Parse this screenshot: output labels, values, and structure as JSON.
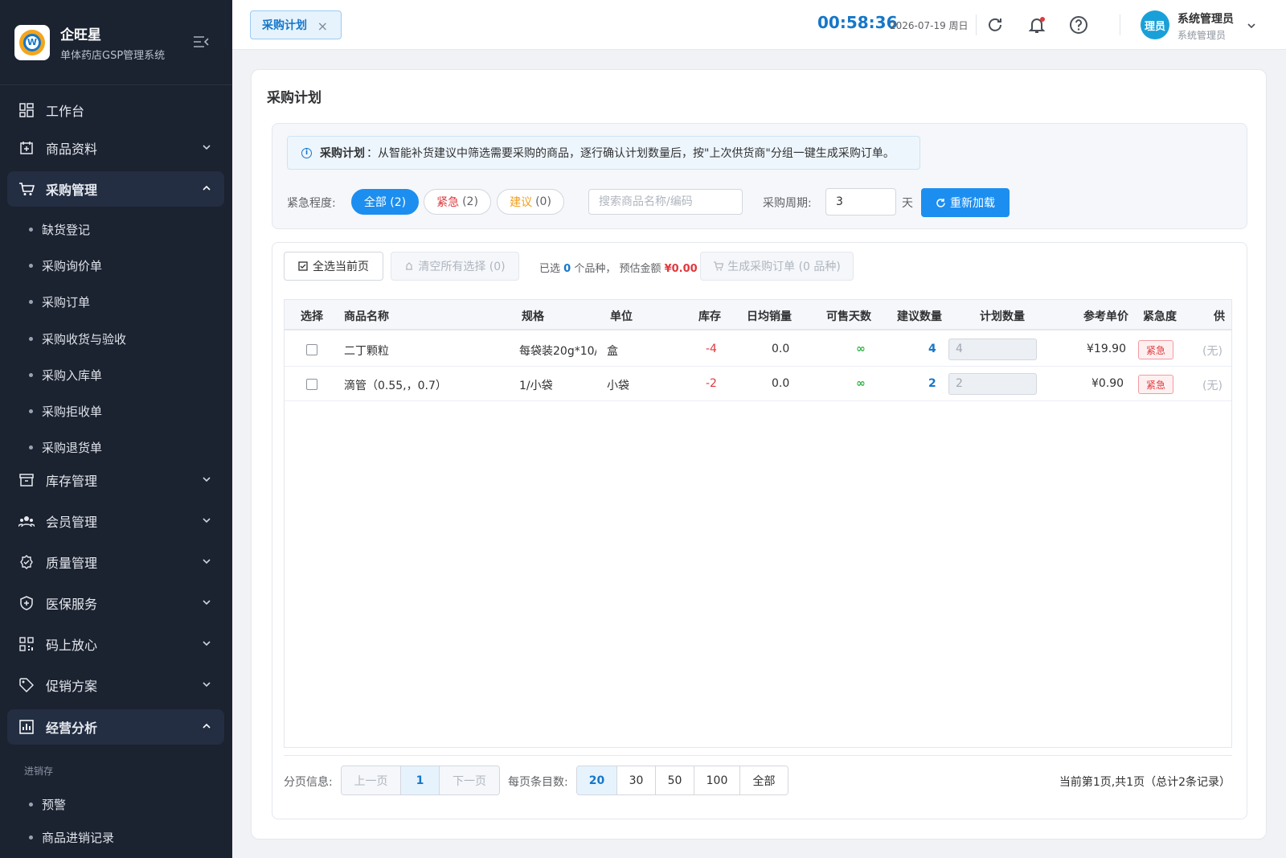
{
  "brand": {
    "name": "企旺星",
    "subtitle": "单体药店GSP管理系统"
  },
  "sidebar": {
    "items": [
      {
        "label": "工作台",
        "icon": "dashboard-icon"
      },
      {
        "label": "商品资料",
        "icon": "product-icon"
      },
      {
        "label": "采购管理",
        "icon": "cart-icon",
        "expanded": true
      },
      {
        "label": "库存管理",
        "icon": "archive-icon"
      },
      {
        "label": "会员管理",
        "icon": "users-icon"
      },
      {
        "label": "质量管理",
        "icon": "badge-check-icon"
      },
      {
        "label": "医保服务",
        "icon": "shield-icon"
      },
      {
        "label": "码上放心",
        "icon": "qrcode-icon"
      },
      {
        "label": "促销方案",
        "icon": "tag-icon"
      },
      {
        "label": "经营分析",
        "icon": "chart-icon",
        "expanded": true
      }
    ],
    "purchase_sub": [
      "缺货登记",
      "采购询价单",
      "采购订单",
      "采购收货与验收",
      "采购入库单",
      "采购拒收单",
      "采购退货单"
    ],
    "analysis_group": "进销存",
    "analysis_sub": [
      "预警",
      "商品进销记录"
    ]
  },
  "header": {
    "tab_label": "采购计划",
    "tab_close": "×",
    "clock": "00:58:36",
    "date": "2026-07-19 周日",
    "avatar_text": "理员",
    "user_name": "系统管理员",
    "user_role": "系统管理员"
  },
  "page": {
    "title": "采购计划",
    "info_title": "采购计划",
    "info_text": "：从智能补货建议中筛选需要采购的商品，逐行确认计划数量后，按\"上次供货商\"分组一键生成采购订单。",
    "urgency_label": "紧急程度:",
    "filter_all": "全部 (2)",
    "filter_urgent": "紧急",
    "filter_urgent_count": "(2)",
    "filter_suggest": "建议",
    "filter_suggest_count": "(0)",
    "search_placeholder": "搜索商品名称/编码",
    "period_label": "采购周期:",
    "period_value": "3",
    "period_unit": "天",
    "reload_label": "重新加载"
  },
  "toolbar": {
    "select_page": "全选当前页",
    "clear_all": "清空所有选择 (0)",
    "selected_prefix": "已选 ",
    "selected_count": "0",
    "selected_mid": " 个品种，  预估金额 ",
    "selected_amount": "¥0.00",
    "generate": "生成采购订单 (0 品种)"
  },
  "table": {
    "headers": [
      "选择",
      "商品名称",
      "规格",
      "单位",
      "库存",
      "日均销量",
      "可售天数",
      "建议数量",
      "计划数量",
      "参考单价",
      "紧急度",
      "供"
    ],
    "rows": [
      {
        "name": "二丁颗粒",
        "spec": "每袋装20g*10/:",
        "unit": "盒",
        "stock": "-4",
        "daily": "0.0",
        "days": "∞",
        "suggest": "4",
        "plan": "4",
        "price": "¥19.90",
        "urgency": "紧急",
        "supplier": "(无)"
      },
      {
        "name": "滴管（0.55,，0.7）",
        "spec": "1/小袋",
        "unit": "小袋",
        "stock": "-2",
        "daily": "0.0",
        "days": "∞",
        "suggest": "2",
        "plan": "2",
        "price": "¥0.90",
        "urgency": "紧急",
        "supplier": "(无)"
      }
    ]
  },
  "pager": {
    "info_label": "分页信息:",
    "prev": "上一页",
    "current": "1",
    "next": "下一页",
    "size_label": "每页条目数:",
    "sizes": [
      "20",
      "30",
      "50",
      "100",
      "全部"
    ],
    "summary": "当前第1页,共1页（总计2条记录）"
  },
  "colors": {
    "accent": "#1c8ef0",
    "sidebar_bg": "#1b2230",
    "danger": "#e0393e",
    "success": "#2fb344"
  }
}
